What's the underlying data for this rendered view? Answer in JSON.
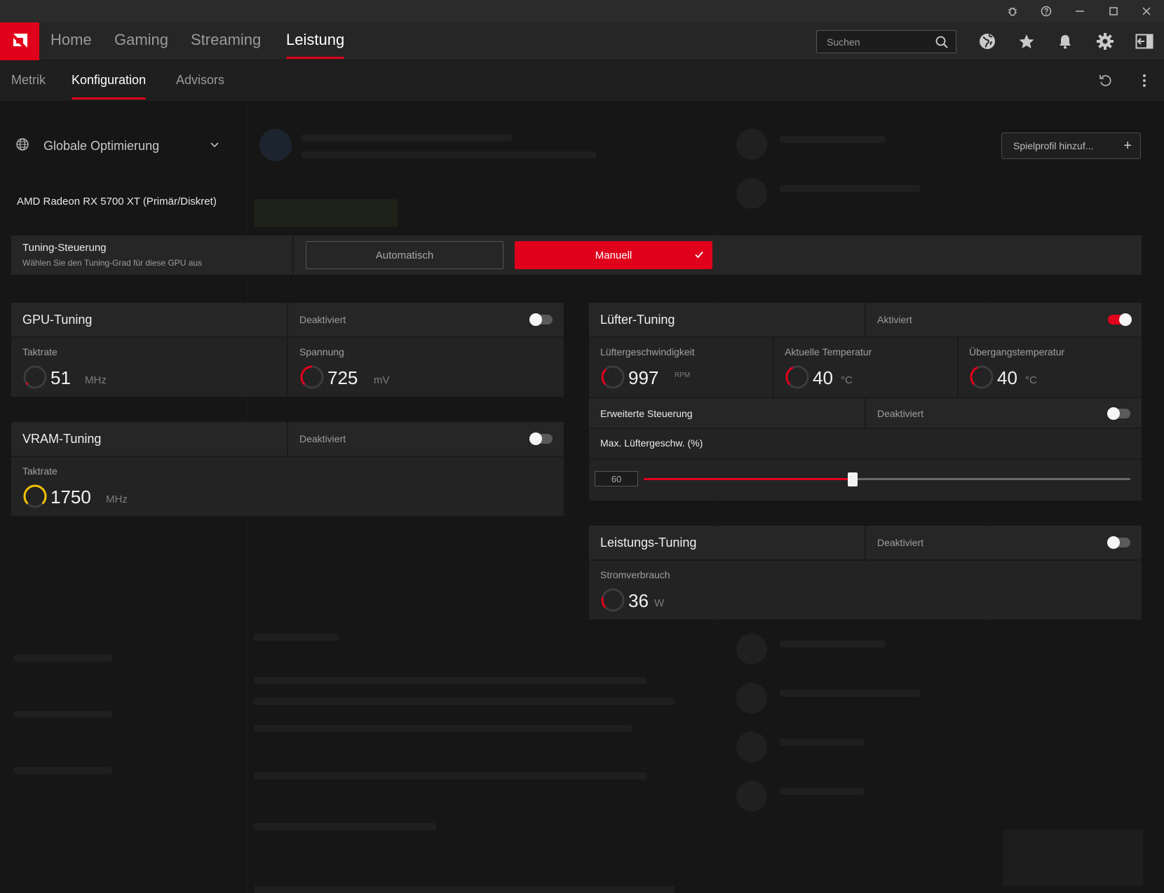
{
  "titlebar": {
    "icons": [
      "bug-icon",
      "help-icon",
      "minimize-icon",
      "maximize-icon",
      "close-icon"
    ]
  },
  "nav": {
    "tabs": [
      "Home",
      "Gaming",
      "Streaming",
      "Leistung"
    ],
    "active": "Leistung",
    "search_placeholder": "Suchen",
    "right_icons": [
      "globe-icon",
      "star-icon",
      "bell-icon",
      "gear-icon",
      "sidebar-toggle-icon"
    ]
  },
  "subnav": {
    "tabs": [
      "Metrik",
      "Konfiguration",
      "Advisors"
    ],
    "active": "Konfiguration"
  },
  "profile": {
    "selected": "Globale Optimierung",
    "add_label": "Spielprofil hinzuf..."
  },
  "gpu_name": "AMD Radeon RX 5700 XT (Primär/Diskret)",
  "tuning_control": {
    "title": "Tuning-Steuerung",
    "description": "Wählen Sie den Tuning-Grad für diese GPU aus",
    "auto_label": "Automatisch",
    "manual_label": "Manuell",
    "selected": "Manuell"
  },
  "gpu_tuning": {
    "title": "GPU-Tuning",
    "state": "Deaktiviert",
    "enabled": false,
    "clock": {
      "label": "Taktrate",
      "value": "51",
      "unit": "MHz"
    },
    "voltage": {
      "label": "Spannung",
      "value": "725",
      "unit": "mV"
    }
  },
  "vram_tuning": {
    "title": "VRAM-Tuning",
    "state": "Deaktiviert",
    "enabled": false,
    "clock": {
      "label": "Taktrate",
      "value": "1750",
      "unit": "MHz"
    }
  },
  "fan_tuning": {
    "title": "Lüfter-Tuning",
    "state": "Aktiviert",
    "enabled": true,
    "fan_speed": {
      "label": "Lüftergeschwindigkeit",
      "value": "997",
      "unit": "RPM"
    },
    "current_temp": {
      "label": "Aktuelle Temperatur",
      "value": "40",
      "unit": "°C"
    },
    "junction_temp": {
      "label": "Übergangstemperatur",
      "value": "40",
      "unit": "°C"
    },
    "advanced": {
      "label": "Erweiterte Steuerung",
      "state": "Deaktiviert",
      "enabled": false
    },
    "max_speed": {
      "label": "Max. Lüftergeschw. (%)",
      "value": "60"
    }
  },
  "power_tuning": {
    "title": "Leistungs-Tuning",
    "state": "Deaktiviert",
    "enabled": false,
    "consumption": {
      "label": "Stromverbrauch",
      "value": "36",
      "unit": "W"
    }
  },
  "colors": {
    "accent": "#e0001b",
    "vram_gauge": "#f2c200",
    "background": "#141414",
    "panel": "#262626"
  }
}
